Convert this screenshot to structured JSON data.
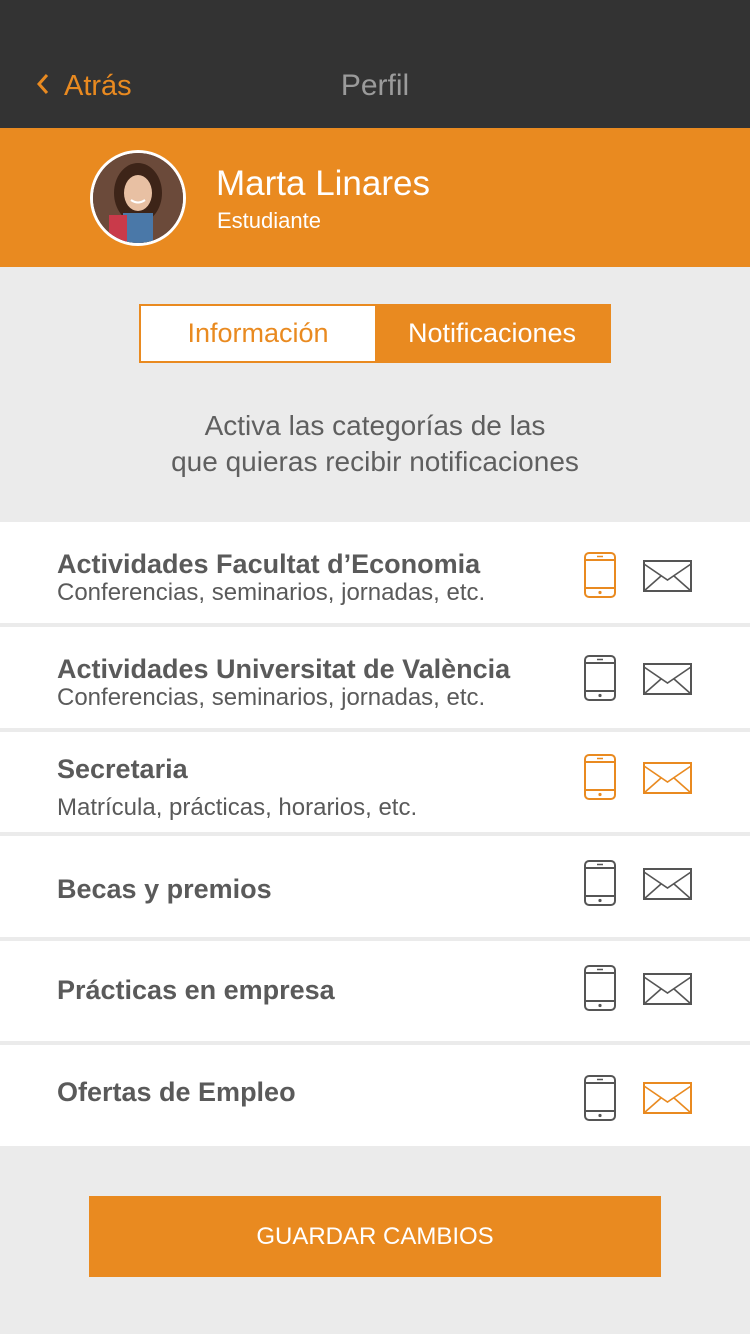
{
  "colors": {
    "accent": "#e98a20",
    "navbar": "#333333",
    "text": "#5a5a5a",
    "icon_off": "#555555"
  },
  "navbar": {
    "back_icon": "chevron-left-icon",
    "back_label": "Atrás",
    "title": "Perfil"
  },
  "profile": {
    "name": "Marta Linares",
    "role": "Estudiante"
  },
  "tabs": [
    {
      "label": "Información",
      "active": false
    },
    {
      "label": "Notificaciones",
      "active": true
    }
  ],
  "instructions": {
    "line1": "Activa las categorías de las",
    "line2": "que quieras recibir notificaciones"
  },
  "categories": [
    {
      "title": "Actividades Facultat d’Economia",
      "subtitle": "Conferencias, seminarios, jornadas, etc.",
      "push_enabled": true,
      "email_enabled": false
    },
    {
      "title": "Actividades Universitat de València",
      "subtitle": "Conferencias, seminarios, jornadas, etc.",
      "push_enabled": false,
      "email_enabled": false
    },
    {
      "title": "Secretaria",
      "subtitle": "Matrícula, prácticas, horarios, etc.",
      "push_enabled": true,
      "email_enabled": true
    },
    {
      "title": "Becas y premios",
      "subtitle": "",
      "push_enabled": false,
      "email_enabled": false
    },
    {
      "title": "Prácticas en empresa",
      "subtitle": "",
      "push_enabled": false,
      "email_enabled": false
    },
    {
      "title": "Ofertas de Empleo",
      "subtitle": "",
      "push_enabled": false,
      "email_enabled": true
    }
  ],
  "save_button": {
    "label": "GUARDAR CAMBIOS"
  }
}
